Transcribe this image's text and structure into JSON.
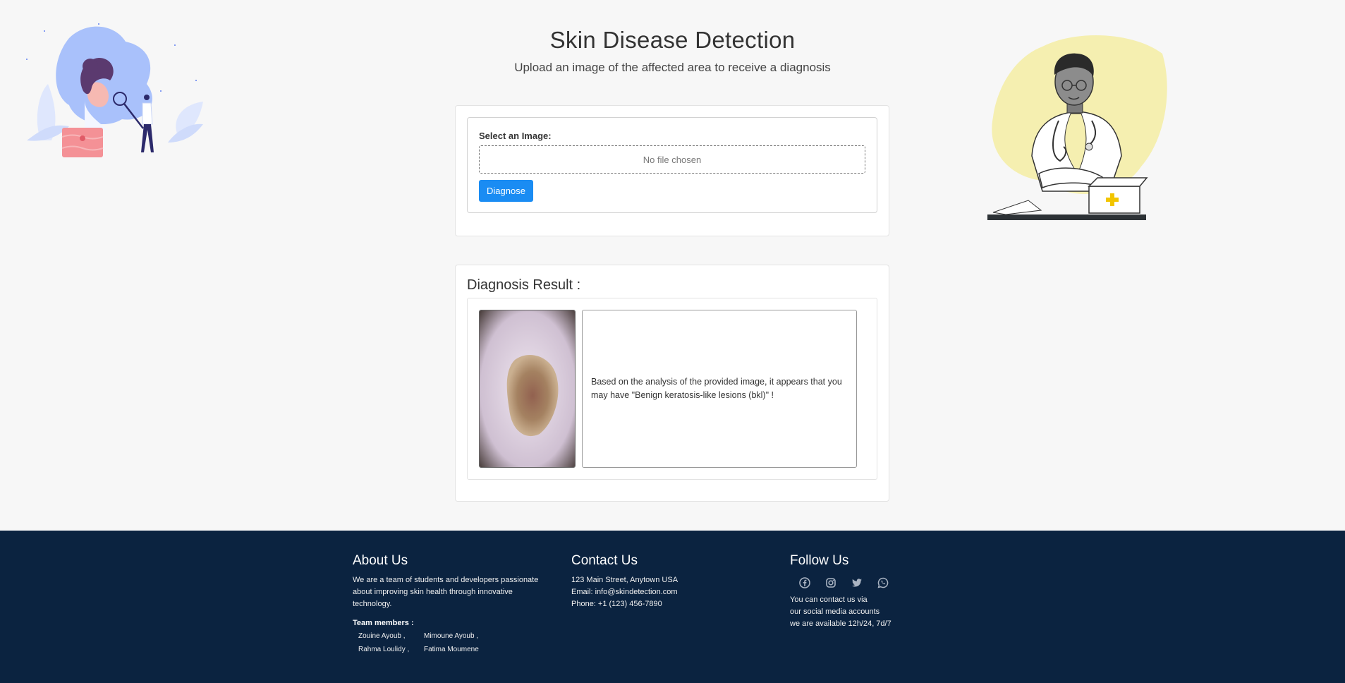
{
  "header": {
    "title": "Skin Disease Detection",
    "subtitle": "Upload an image of the affected area to receive a diagnosis"
  },
  "upload": {
    "label": "Select an Image:",
    "file_status": "No file chosen",
    "button_label": "Diagnose"
  },
  "result": {
    "title": "Diagnosis Result :",
    "text": "Based on the analysis of the provided image, it appears that you may have \"Benign keratosis-like lesions (bkl)\" !"
  },
  "footer": {
    "about": {
      "heading": "About Us",
      "text": "We are a team of students and developers passionate about improving skin health through innovative technology.",
      "team_label": "Team members :",
      "members": [
        "Zouine Ayoub ,",
        "Mimoune Ayoub ,",
        "Rahma Loulidy ,",
        "Fatima Moumene"
      ]
    },
    "contact": {
      "heading": "Contact Us",
      "address": "123 Main Street, Anytown USA",
      "email": "Email: info@skindetection.com",
      "phone": "Phone: +1 (123) 456-7890"
    },
    "follow": {
      "heading": "Follow Us",
      "icons": [
        "facebook-icon",
        "instagram-icon",
        "twitter-icon",
        "whatsapp-icon"
      ],
      "line1": "You can contact us via",
      "line2": "our social media accounts",
      "line3": "we are available 12h/24, 7d/7"
    }
  },
  "colors": {
    "page_bg": "#f7f7f7",
    "accent": "#1a8cf3",
    "footer_bg": "#0b2340"
  }
}
